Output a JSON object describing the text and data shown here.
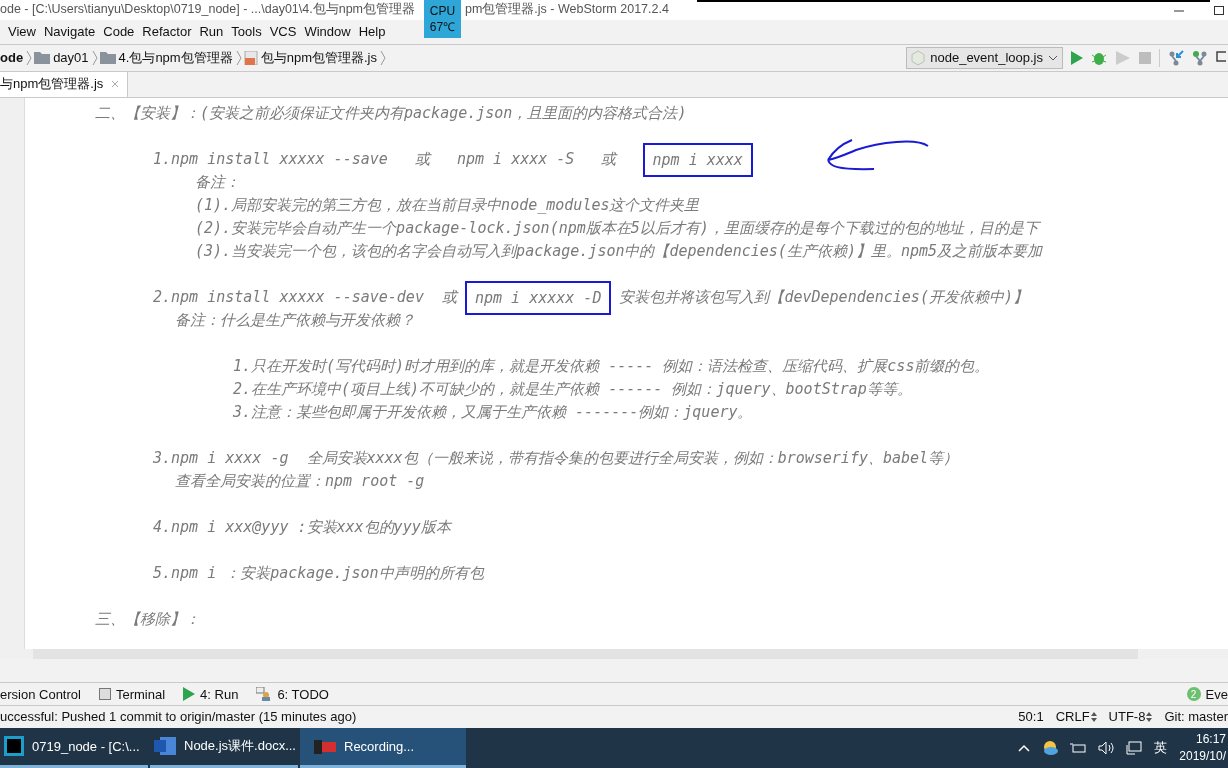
{
  "title_bar": {
    "title_left": "ode - [C:\\Users\\tianyu\\Desktop\\0719_node] - ...\\day01\\4.包与npm包管理器",
    "title_right": "pm包管理器.js - WebStorm 2017.2.4",
    "overlay": {
      "label": "CPU",
      "reading": "67℃"
    }
  },
  "menu": [
    "View",
    "Navigate",
    "Code",
    "Refactor",
    "Run",
    "Tools",
    "VCS",
    "Window",
    "Help"
  ],
  "breadcrumbs": [
    {
      "kind": "project",
      "label": "ode"
    },
    {
      "kind": "folder",
      "label": "day01"
    },
    {
      "kind": "folder",
      "label": "4.包与npm包管理器"
    },
    {
      "kind": "file",
      "label": "包与npm包管理器.js"
    }
  ],
  "run_config": "node_event_loop.js",
  "tabs": [
    {
      "label": "与npm包管理器.js",
      "selected": true
    }
  ],
  "editor": {
    "blocks": [
      [
        {
          "kind": "heading",
          "segments": [
            {
              "text": "二、【安装】：(安装之前必须保证文件夹内有package.json，且里面的内容格式合法)",
              "boxed": false
            }
          ]
        }
      ],
      [
        {
          "kind": "item",
          "segments": [
            {
              "text": "1.npm install xxxxx --save   或   npm i xxxx -S   或  ",
              "boxed": false
            },
            {
              "text": "npm i xxxx",
              "boxed": true
            }
          ]
        },
        {
          "kind": "note",
          "segments": [
            {
              "text": "备注：",
              "boxed": false
            }
          ]
        },
        {
          "kind": "note",
          "segments": [
            {
              "text": "(1).局部安装完的第三方包，放在当前目录中node_modules这个文件夹里",
              "boxed": false
            }
          ]
        },
        {
          "kind": "note",
          "segments": [
            {
              "text": "(2).安装完毕会自动产生一个package-lock.json(npm版本在5以后才有)，里面缓存的是每个下载过的包的地址，目的是下",
              "boxed": false
            }
          ]
        },
        {
          "kind": "note",
          "segments": [
            {
              "text": "(3).当安装完一个包，该包的名字会自动写入到package.json中的【dependencies(生产依赖)】里。npm5及之前版本要加",
              "boxed": false
            }
          ]
        }
      ],
      [
        {
          "kind": "item",
          "segments": [
            {
              "text": "2.npm install xxxxx --save-dev  或",
              "boxed": false
            },
            {
              "text": "npm i xxxxx -D",
              "boxed": true
            },
            {
              "text": "安装包并将该包写入到【devDependencies(开发依赖中)】",
              "boxed": false
            }
          ]
        },
        {
          "kind": "remark",
          "segments": [
            {
              "text": "备注：什么是生产依赖与开发依赖？",
              "boxed": false
            }
          ]
        }
      ],
      [
        {
          "kind": "example",
          "segments": [
            {
              "text": "1.只在开发时(写代码时)时才用到的库，就是开发依赖 ----- 例如：语法检查、压缩代码、扩展css前缀的包。",
              "boxed": false
            }
          ]
        },
        {
          "kind": "example",
          "segments": [
            {
              "text": "2.在生产环境中(项目上线)不可缺少的，就是生产依赖 ------ 例如：jquery、bootStrap等等。",
              "boxed": false
            }
          ]
        },
        {
          "kind": "example",
          "segments": [
            {
              "text": "3.注意：某些包即属于开发依赖，又属于生产依赖 -------例如：jquery。",
              "boxed": false
            }
          ]
        }
      ],
      [
        {
          "kind": "item",
          "segments": [
            {
              "text": "3.npm i xxxx -g  全局安装xxxx包（一般来说，带有指令集的包要进行全局安装，例如：browserify、babel等）",
              "boxed": false
            }
          ]
        },
        {
          "kind": "remark",
          "segments": [
            {
              "text": "查看全局安装的位置：npm root -g",
              "boxed": false
            }
          ]
        }
      ],
      [
        {
          "kind": "item",
          "segments": [
            {
              "text": "4.npm i xxx@yyy :安装xxx包的yyy版本",
              "boxed": false
            }
          ]
        }
      ],
      [
        {
          "kind": "item",
          "segments": [
            {
              "text": "5.npm i ：安装package.json中声明的所有包",
              "boxed": false
            }
          ]
        }
      ],
      [
        {
          "kind": "heading",
          "segments": [
            {
              "text": "三、【移除】：",
              "boxed": false
            }
          ]
        }
      ]
    ]
  },
  "tool_windows": [
    {
      "kind": "vcs",
      "label": "ersion Control"
    },
    {
      "kind": "terminal",
      "label": "Terminal"
    },
    {
      "kind": "run",
      "label": "4: Run"
    },
    {
      "kind": "todo",
      "label": "6: TODO"
    }
  ],
  "event_log": {
    "count": "2",
    "label": "Eve"
  },
  "status_bar": {
    "message": "uccessful: Pushed 1 commit to origin/master (15 minutes ago)",
    "position": "50:1",
    "line_separator": "CRLF",
    "encoding": "UTF-8",
    "branch": "Git: master"
  },
  "taskbar": {
    "items": [
      {
        "kind": "webstorm",
        "label": "0719_node - [C:\\...",
        "selected": false
      },
      {
        "kind": "word",
        "label": "Node.js课件.docx...",
        "selected": false
      },
      {
        "kind": "recorder",
        "label": "Recording...",
        "selected": true
      }
    ],
    "language": "英",
    "time": "16:17",
    "date": "2019/10/"
  }
}
